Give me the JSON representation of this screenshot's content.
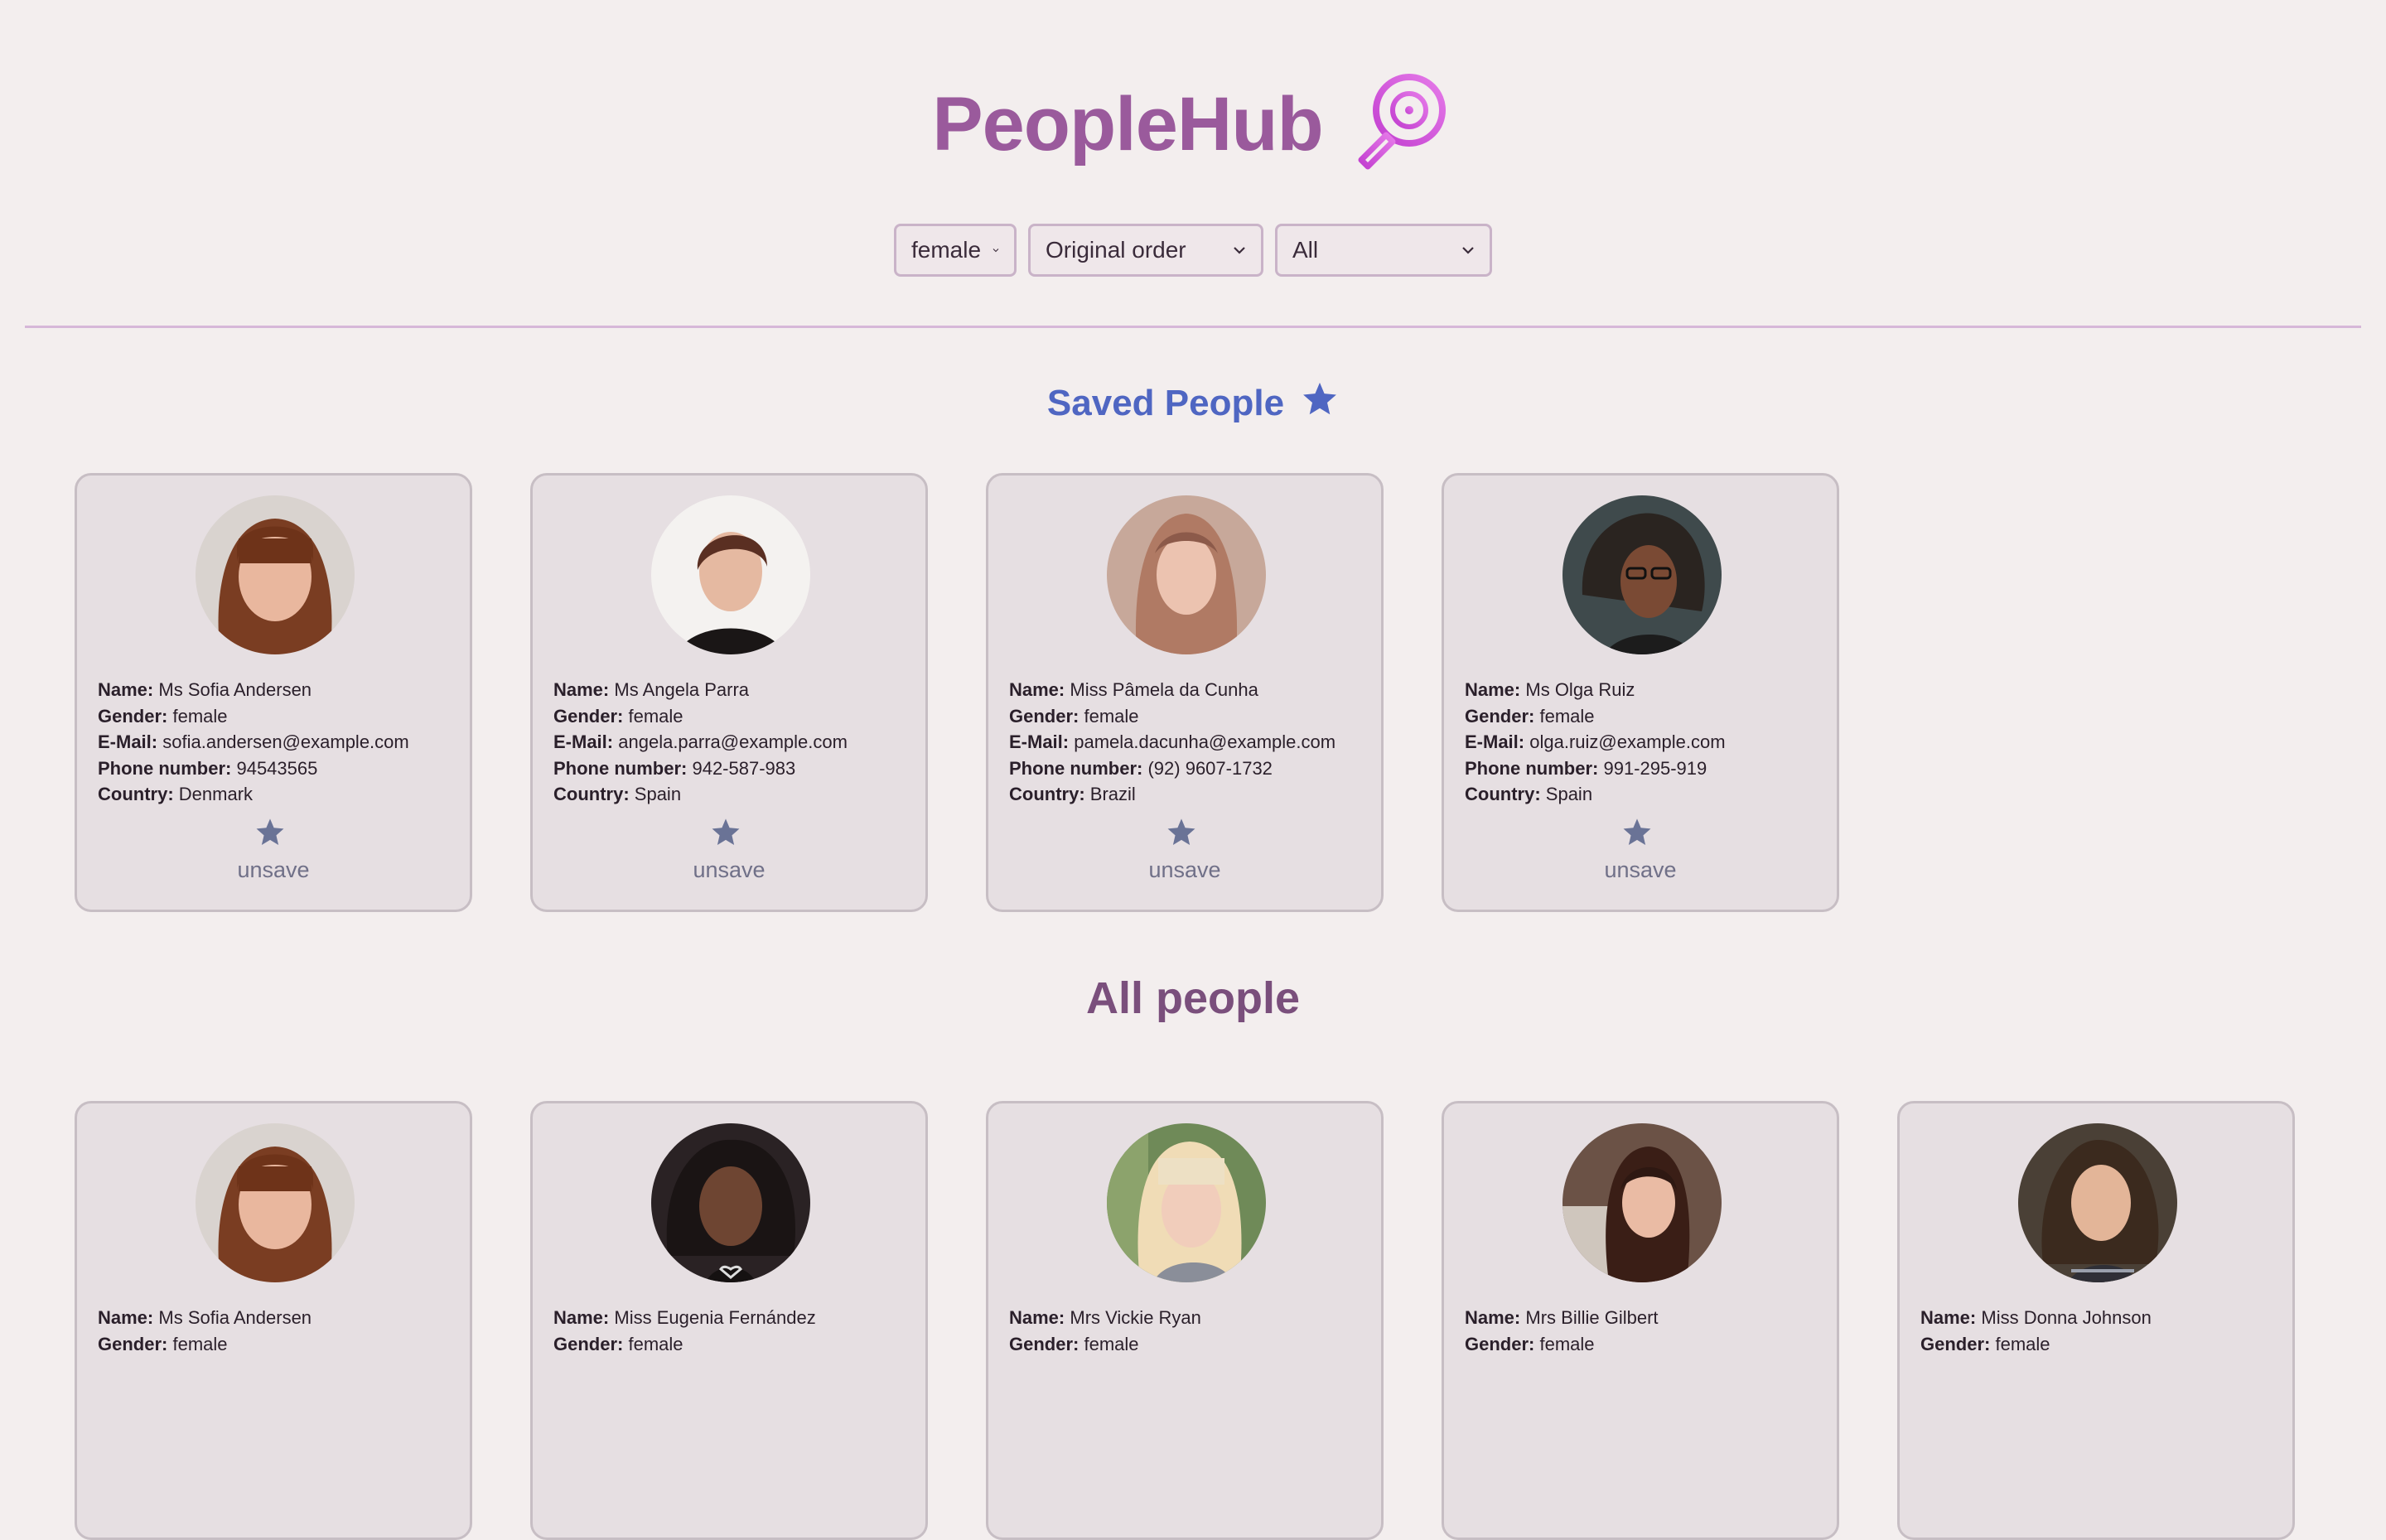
{
  "app": {
    "title": "PeopleHub",
    "logo_icon": "magnifier-target-icon"
  },
  "filters": {
    "gender": "female",
    "order": "Original order",
    "country": "All"
  },
  "saved": {
    "title": "Saved People",
    "title_icon": "star-icon",
    "star_color": "#4f66c2",
    "people": [
      {
        "name": "Ms Sofia Andersen",
        "gender": "female",
        "email": "sofia.andersen@example.com",
        "phone": "94543565",
        "country": "Denmark",
        "action": "unsave"
      },
      {
        "name": "Ms Angela Parra",
        "gender": "female",
        "email": "angela.parra@example.com",
        "phone": "942-587-983",
        "country": "Spain",
        "action": "unsave"
      },
      {
        "name": "Miss Pâmela da Cunha",
        "gender": "female",
        "email": "pamela.dacunha@example.com",
        "phone": "(92) 9607-1732",
        "country": "Brazil",
        "action": "unsave"
      },
      {
        "name": "Ms Olga Ruiz",
        "gender": "female",
        "email": "olga.ruiz@example.com",
        "phone": "991-295-919",
        "country": "Spain",
        "action": "unsave"
      }
    ]
  },
  "all": {
    "title": "All people",
    "people": [
      {
        "name": "Ms Sofia Andersen",
        "gender": "female"
      },
      {
        "name": "Miss Eugenia Fernández",
        "gender": "female"
      },
      {
        "name": "Mrs Vickie Ryan",
        "gender": "female"
      },
      {
        "name": "Mrs Billie Gilbert",
        "gender": "female"
      },
      {
        "name": "Miss Donna Johnson",
        "gender": "female"
      }
    ]
  },
  "labels": {
    "name": "Name:",
    "gender": "Gender:",
    "email": "E-Mail:",
    "phone": "Phone number:",
    "country": "Country:"
  },
  "colors": {
    "title": "#9a5a9c",
    "saved_title": "#4f66c2",
    "all_title": "#7a4f7c",
    "card_star": "#6a7396",
    "background": "#f3eeee"
  }
}
